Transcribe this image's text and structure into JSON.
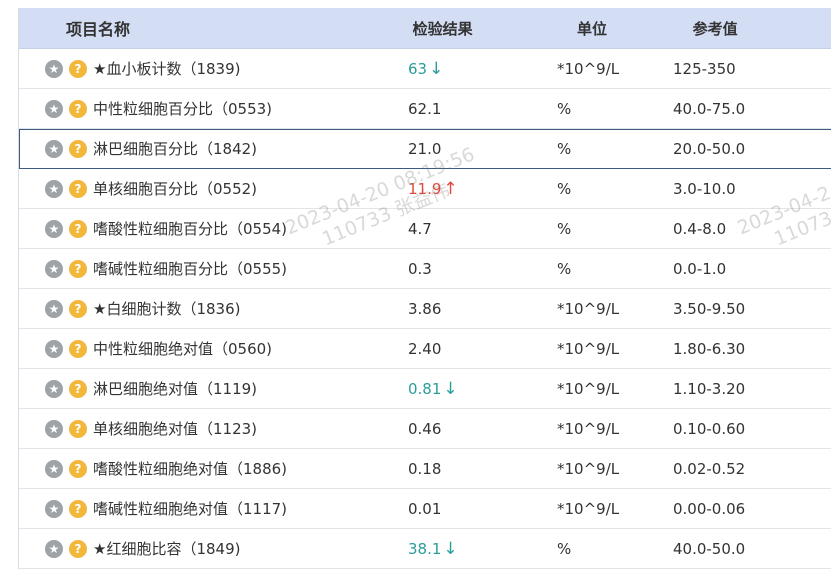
{
  "header": {
    "name": "项目名称",
    "result": "检验结果",
    "unit": "单位",
    "reference": "参考值"
  },
  "icons": {
    "star": "star-icon",
    "help": "question-icon"
  },
  "colors": {
    "header_bg": "#d3ddf4",
    "low": "#2a9d9a",
    "high": "#e5483a",
    "help_icon": "#f3b73b"
  },
  "rows": [
    {
      "name": "★血小板计数（1839)",
      "result": "63",
      "flag": "↓",
      "unit": "*10^9/L",
      "ref": "125-350"
    },
    {
      "name": "中性粒细胞百分比（0553)",
      "result": "62.1",
      "flag": "",
      "unit": "%",
      "ref": "40.0-75.0"
    },
    {
      "name": "淋巴细胞百分比（1842)",
      "result": "21.0",
      "flag": "",
      "unit": "%",
      "ref": "20.0-50.0"
    },
    {
      "name": "单核细胞百分比（0552)",
      "result": "11.9",
      "flag": "↑",
      "unit": "%",
      "ref": "3.0-10.0"
    },
    {
      "name": "嗜酸性粒细胞百分比（0554)",
      "result": "4.7",
      "flag": "",
      "unit": "%",
      "ref": "0.4-8.0"
    },
    {
      "name": "嗜碱性粒细胞百分比（0555)",
      "result": "0.3",
      "flag": "",
      "unit": "%",
      "ref": "0.0-1.0"
    },
    {
      "name": "★白细胞计数（1836)",
      "result": "3.86",
      "flag": "",
      "unit": "*10^9/L",
      "ref": "3.50-9.50"
    },
    {
      "name": "中性粒细胞绝对值（0560)",
      "result": "2.40",
      "flag": "",
      "unit": "*10^9/L",
      "ref": "1.80-6.30"
    },
    {
      "name": "淋巴细胞绝对值（1119)",
      "result": "0.81",
      "flag": "↓",
      "unit": "*10^9/L",
      "ref": "1.10-3.20"
    },
    {
      "name": "单核细胞绝对值（1123)",
      "result": "0.46",
      "flag": "",
      "unit": "*10^9/L",
      "ref": "0.10-0.60"
    },
    {
      "name": "嗜酸性粒细胞绝对值（1886)",
      "result": "0.18",
      "flag": "",
      "unit": "*10^9/L",
      "ref": "0.02-0.52"
    },
    {
      "name": "嗜碱性粒细胞绝对值（1117)",
      "result": "0.01",
      "flag": "",
      "unit": "*10^9/L",
      "ref": "0.00-0.06"
    },
    {
      "name": "★红细胞比容（1849)",
      "result": "38.1",
      "flag": "↓",
      "unit": "%",
      "ref": "40.0-50.0"
    }
  ],
  "selected_row": 2,
  "watermark": {
    "datetime": "2023-04-20 08:19:56",
    "user": "110733 张益伟",
    "datetime_partial": "2023-04-2",
    "user_partial": "11073"
  }
}
